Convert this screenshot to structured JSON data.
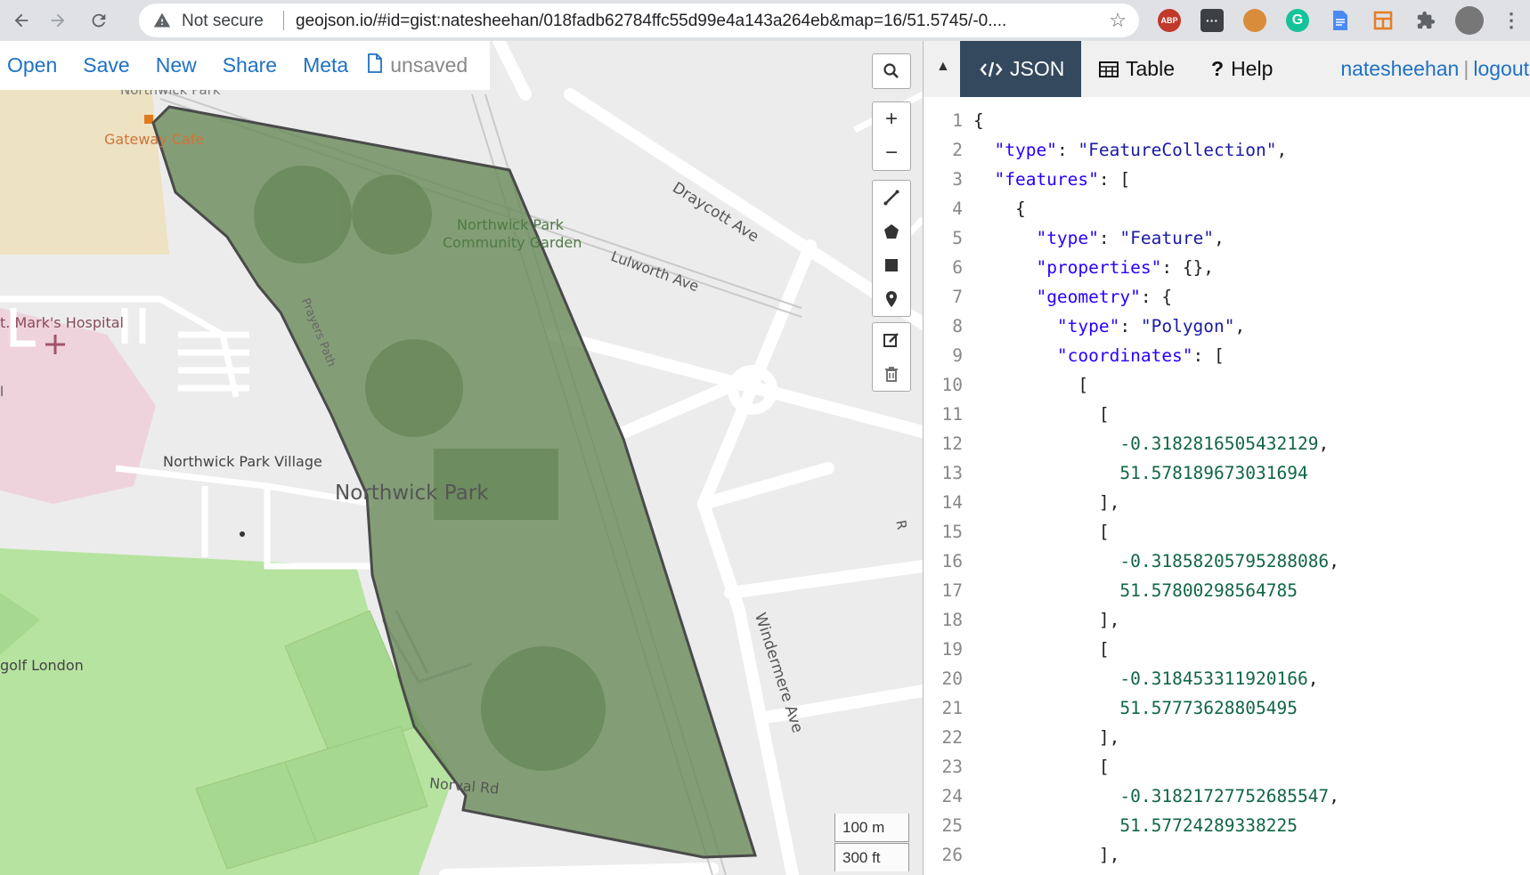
{
  "browser": {
    "security_label": "Not secure",
    "url": "geojson.io/#id=gist:natesheehan/018fadb62784ffc55d99e4a143a264eb&map=16/51.5745/-0....",
    "icons": [
      "back-arrow-icon",
      "forward-arrow-icon",
      "reload-icon",
      "warning-icon",
      "star-icon",
      "adblock-icon",
      "extension-icon",
      "cookie-icon",
      "grammarly-icon",
      "docs-icon",
      "layout-icon",
      "puzzle-icon",
      "profile-avatar",
      "more-vert-icon"
    ],
    "ext_adblock_label": "ABP"
  },
  "toolbar": {
    "menu": [
      "Open",
      "Save",
      "New",
      "Share",
      "Meta"
    ],
    "file_status": "unsaved"
  },
  "map": {
    "labels": {
      "northwick_park_top": "Northwick Park",
      "gateway_cafe": "Gateway Cafe",
      "community_garden_1": "Northwick Park",
      "community_garden_2": "Community Garden",
      "hospital": "t. Mark's Hospital",
      "village": "Northwick Park Village",
      "park": "Northwick Park",
      "golf": "golf London",
      "draycott": "Draycott Ave",
      "lulworth": "Lulworth Ave",
      "windermere": "Windermere Ave",
      "norval": "Norval Rd",
      "prayers_path": "Prayers Path",
      "edge_r": "R",
      "edge_l": "l"
    },
    "scale": {
      "metric": "100 m",
      "imperial": "300 ft"
    },
    "colors": {
      "polygon_fill": "#6b8c5c",
      "polygon_stroke": "#4a4a4a",
      "park_green": "#b6e3a0"
    }
  },
  "panel": {
    "tabs": [
      {
        "label": "JSON",
        "active": true
      },
      {
        "label": "Table",
        "active": false
      },
      {
        "label": "Help",
        "active": false
      }
    ],
    "help_prefix": "?",
    "user": {
      "name": "natesheehan",
      "separator": "|",
      "logout": "logout"
    },
    "accent": "#34495e"
  },
  "editor": {
    "line_numbers": [
      "1",
      "2",
      "3",
      "4",
      "5",
      "6",
      "7",
      "8",
      "9",
      "10",
      "11",
      "12",
      "13",
      "14",
      "15",
      "16",
      "17",
      "18",
      "19",
      "20",
      "21",
      "22",
      "23",
      "24",
      "25",
      "26"
    ],
    "lines": [
      "{",
      "  \"type\": \"FeatureCollection\",",
      "  \"features\": [",
      "    {",
      "      \"type\": \"Feature\",",
      "      \"properties\": {},",
      "      \"geometry\": {",
      "        \"type\": \"Polygon\",",
      "        \"coordinates\": [",
      "          [",
      "            [",
      "              -0.3182816505432129,",
      "              51.578189673031694",
      "            ],",
      "            [",
      "              -0.31858205795288086,",
      "              51.57800298564785",
      "            ],",
      "            [",
      "              -0.318453311920166,",
      "              51.57773628805495",
      "            ],",
      "            [",
      "              -0.31821727752685547,",
      "              51.57724289338225",
      "            ],"
    ]
  }
}
